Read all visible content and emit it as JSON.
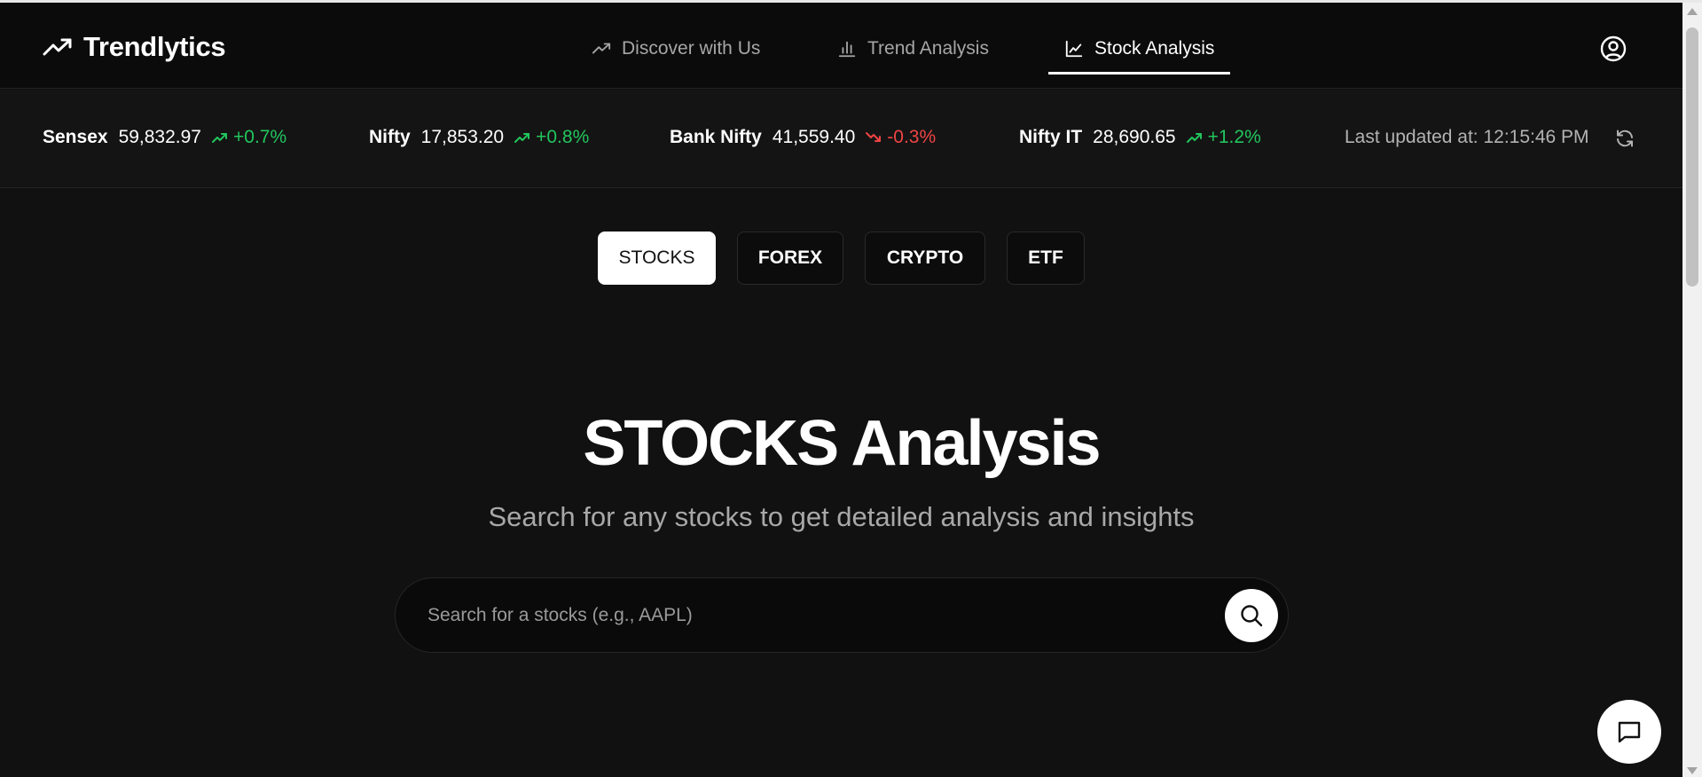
{
  "brand": {
    "name": "Trendlytics",
    "icon": "trending-up-icon"
  },
  "nav": {
    "items": [
      {
        "label": "Discover with Us",
        "icon": "trending-up-icon",
        "active": false
      },
      {
        "label": "Trend Analysis",
        "icon": "bar-chart-icon",
        "active": false
      },
      {
        "label": "Stock Analysis",
        "icon": "line-chart-icon",
        "active": true
      }
    ],
    "user_icon": "user-circle-icon"
  },
  "ticker": {
    "items": [
      {
        "name": "Sensex",
        "value": "59,832.97",
        "change": "+0.7%",
        "direction": "up"
      },
      {
        "name": "Nifty",
        "value": "17,853.20",
        "change": "+0.8%",
        "direction": "up"
      },
      {
        "name": "Bank Nifty",
        "value": "41,559.40",
        "change": "-0.3%",
        "direction": "down"
      },
      {
        "name": "Nifty IT",
        "value": "28,690.65",
        "change": "+1.2%",
        "direction": "up"
      }
    ],
    "last_updated": "Last updated at: 12:15:46 PM",
    "refresh_icon": "refresh-icon"
  },
  "tabs": [
    {
      "label": "STOCKS",
      "active": true
    },
    {
      "label": "FOREX",
      "active": false
    },
    {
      "label": "CRYPTO",
      "active": false
    },
    {
      "label": "ETF",
      "active": false
    }
  ],
  "hero": {
    "title": "STOCKS Analysis",
    "subtitle": "Search for any stocks to get detailed analysis and insights"
  },
  "search": {
    "placeholder": "Search for a stocks (e.g., AAPL)",
    "value": "",
    "button_icon": "search-icon"
  },
  "chat": {
    "icon": "chat-icon"
  },
  "colors": {
    "background": "#111111",
    "header": "#0b0b0b",
    "positive": "#22c55e",
    "negative": "#ef4444",
    "muted_text": "#a8a8a8"
  }
}
